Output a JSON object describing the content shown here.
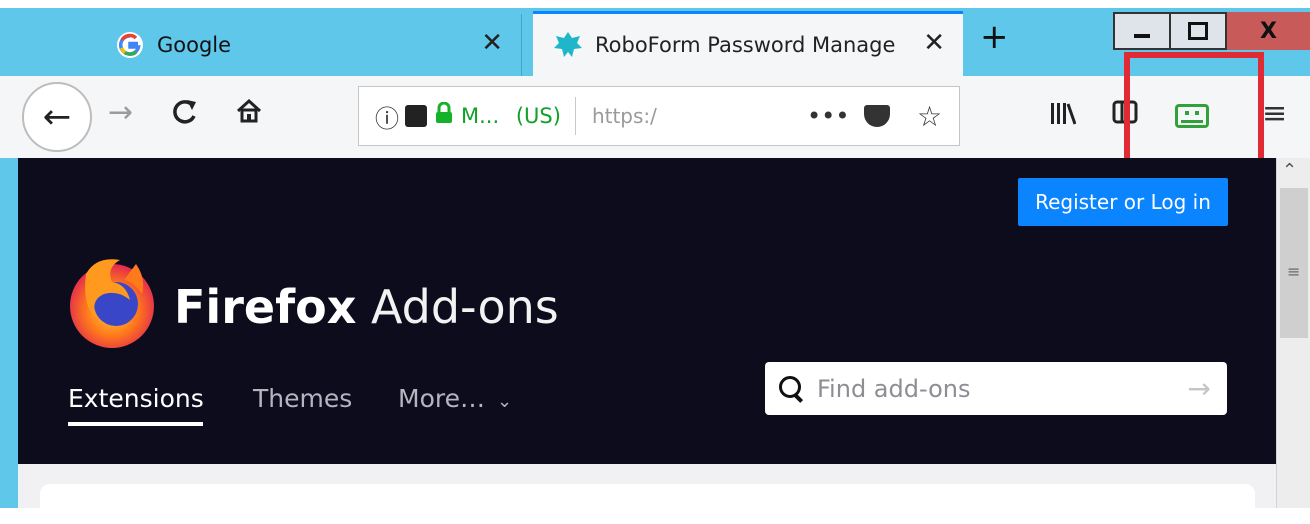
{
  "tabs": [
    {
      "title": "Google",
      "favicon": "google-g-icon"
    },
    {
      "title": "RoboForm Password Manage",
      "favicon": "roboform-icon",
      "active": true
    }
  ],
  "window_controls": {
    "minimize": "▁",
    "maximize": "□",
    "close": "X"
  },
  "new_tab_label": "+",
  "toolbar": {
    "back": "←",
    "forward": "→",
    "reload": "C",
    "home": "⌂",
    "url": {
      "identity_short": "M...",
      "country": "(US)",
      "text": "https:/",
      "page_actions": "•••"
    },
    "menu": "≡"
  },
  "page": {
    "register_button": "Register or Log in",
    "brand_strong": "Firefox",
    "brand_light": "Add-ons",
    "nav": {
      "extensions": "Extensions",
      "themes": "Themes",
      "more": "More…"
    },
    "search": {
      "placeholder": "Find add-ons",
      "submit_arrow": "→"
    }
  },
  "colors": {
    "titlebar": "#5fc7ea",
    "page_header_bg": "#0c0c1c",
    "accent_blue": "#0a84ff",
    "secure_green": "#12a029",
    "roboform_green": "#2fa23a",
    "highlight_red": "#e02b35"
  }
}
